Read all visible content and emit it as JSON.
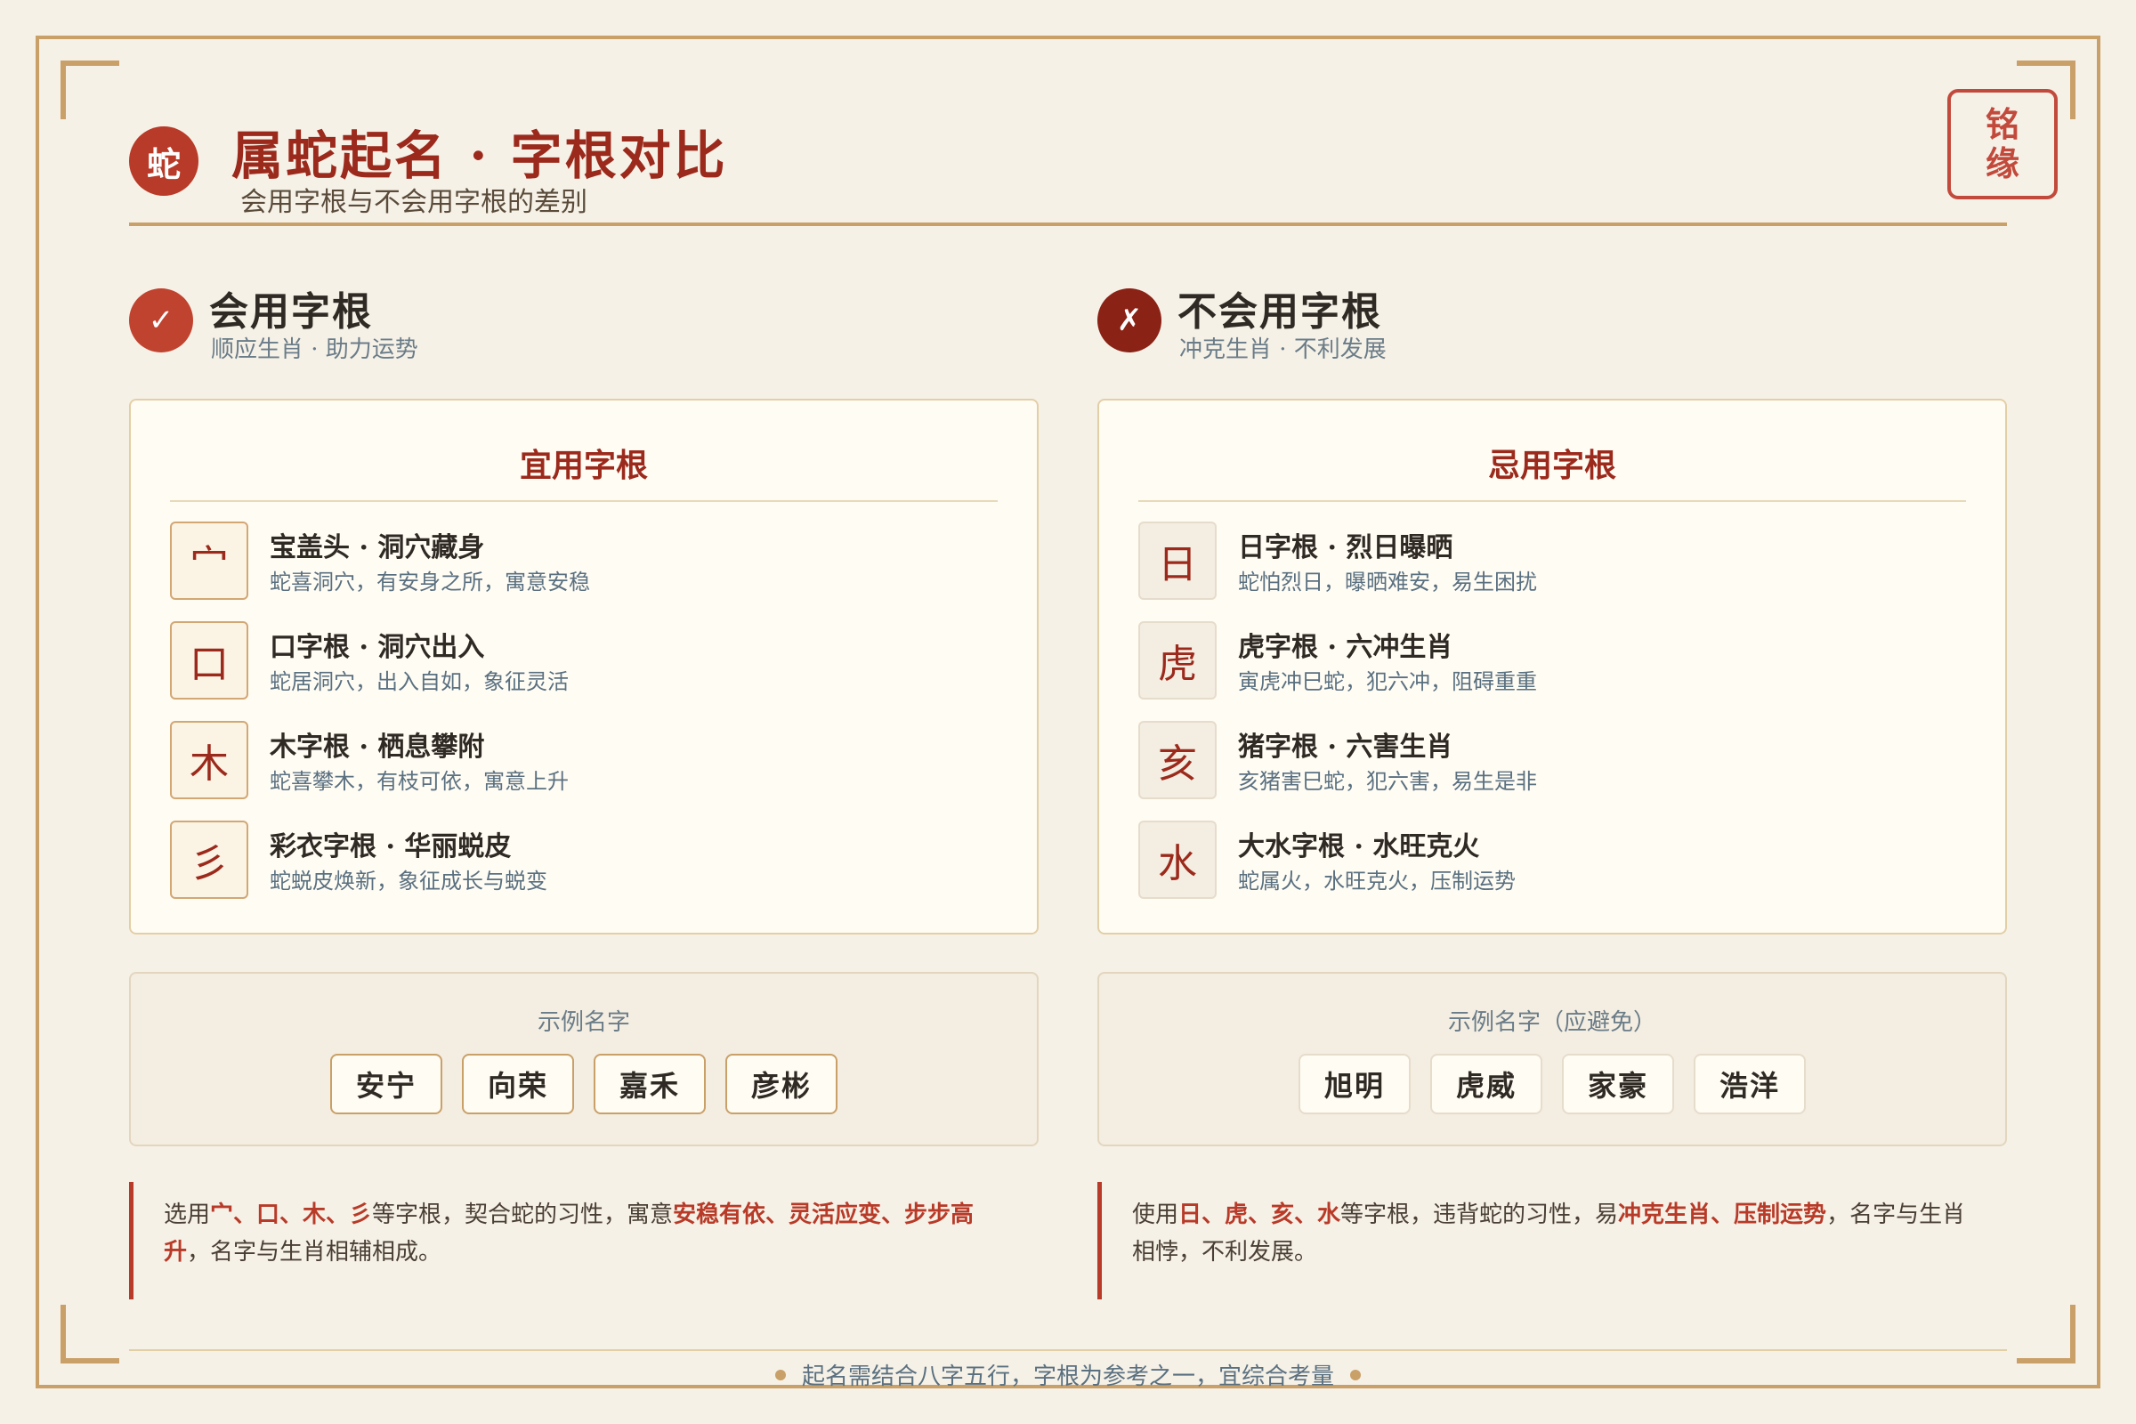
{
  "header": {
    "badge": "蛇",
    "title": "属蛇起名 · 字根对比",
    "subtitle": "会用字根与不会用字根的差别",
    "seal": "铭缘"
  },
  "good": {
    "icon": "✓",
    "title": "会用字根",
    "subtitle": "顺应生肖 · 助力运势",
    "card_title": "宜用字根",
    "items": [
      {
        "glyph": "宀",
        "title": "宝盖头 · 洞穴藏身",
        "desc": "蛇喜洞穴，有安身之所，寓意安稳"
      },
      {
        "glyph": "口",
        "title": "口字根 · 洞穴出入",
        "desc": "蛇居洞穴，出入自如，象征灵活"
      },
      {
        "glyph": "木",
        "title": "木字根 · 栖息攀附",
        "desc": "蛇喜攀木，有枝可依，寓意上升"
      },
      {
        "glyph": "彡",
        "title": "彩衣字根 · 华丽蜕皮",
        "desc": "蛇蜕皮焕新，象征成长与蜕变"
      }
    ],
    "example_label": "示例名字",
    "examples": [
      "安宁",
      "向荣",
      "嘉禾",
      "彦彬"
    ],
    "note": {
      "p1": "选用",
      "h1": "宀、口、木、彡",
      "p2": "等字根，契合蛇的习性，寓意",
      "h2": "安稳有依、灵活应变、步步高升",
      "p3": "，名字与生肖相辅相成。"
    }
  },
  "bad": {
    "icon": "✗",
    "title": "不会用字根",
    "subtitle": "冲克生肖 · 不利发展",
    "card_title": "忌用字根",
    "items": [
      {
        "glyph": "日",
        "title": "日字根 · 烈日曝晒",
        "desc": "蛇怕烈日，曝晒难安，易生困扰"
      },
      {
        "glyph": "虎",
        "title": "虎字根 · 六冲生肖",
        "desc": "寅虎冲巳蛇，犯六冲，阻碍重重"
      },
      {
        "glyph": "亥",
        "title": "猪字根 · 六害生肖",
        "desc": "亥猪害巳蛇，犯六害，易生是非"
      },
      {
        "glyph": "水",
        "title": "大水字根 · 水旺克火",
        "desc": "蛇属火，水旺克火，压制运势"
      }
    ],
    "example_label": "示例名字（应避免）",
    "examples": [
      "旭明",
      "虎威",
      "家豪",
      "浩洋"
    ],
    "note": {
      "p1": "使用",
      "h1": "日、虎、亥、水",
      "p2": "等字根，违背蛇的习性，易",
      "h2": "冲克生肖、压制运势",
      "p3": "，名字与生肖相悖，不利发展。"
    }
  },
  "footer": "起名需结合八字五行，字根为参考之一，宜综合考量",
  "colors": {
    "accent": "#9b2a1c",
    "gold": "#c9a068",
    "background": "#f6f1e7"
  }
}
